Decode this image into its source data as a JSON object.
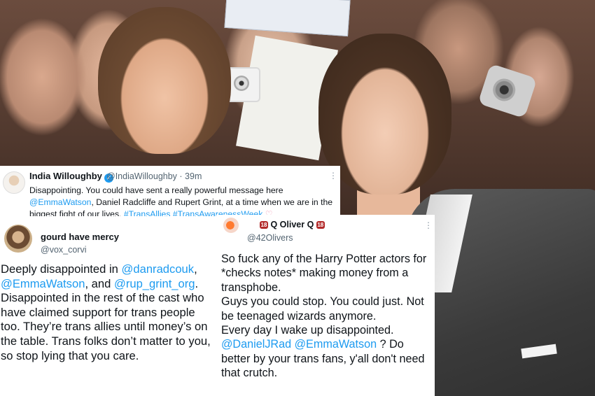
{
  "tweet_india": {
    "name": "India Willoughby",
    "handle": "@IndiaWilloughby",
    "time": "· 39m",
    "text_start": "Disappointing. You could have sent a really powerful message here",
    "mention_1": "@EmmaWatson",
    "text_mid": ", Daniel Radcliffe and Rupert Grint, at a time when we are in the biggest fight of our lives. ",
    "hashtag_1": "#TransAllies",
    "hashtag_2": "#TransAwarenessWeek",
    "emoji": "♡",
    "more_icon": "ellipsis-icon"
  },
  "tweet_gourd": {
    "name": "gourd have mercy",
    "handle": "@vox_corvi",
    "text_1": "Deeply disappointed in ",
    "mention_1": "@danradcouk",
    "text_2": ", ",
    "mention_2": "@EmmaWatson",
    "text_3": ", and ",
    "mention_3": "@rup_grint_org",
    "text_4": ". Disappointed in the rest of the cast who have claimed support for trans people too. They’re trans allies until money’s on the table. Trans folks don’t matter to you, so stop lying that you care."
  },
  "tweet_oliver": {
    "badge_left": "18",
    "name": "Q Oliver Q",
    "badge_right": "18",
    "handle": "@42Olivers",
    "text_1": "So fuck any of the Harry Potter actors for *checks notes* making money from a transphobe.",
    "text_2": "Guys you could stop. You could just. Not be teenaged wizards anymore.",
    "text_3": "Every day I wake up disappointed.",
    "mention_1": "@DanielJRad",
    "mention_2": "@EmmaWatson",
    "text_4": " ? Do better by your trans fans, y'all don't need that crutch.",
    "more_icon": "ellipsis-icon"
  },
  "colors": {
    "link": "#1d9bf0",
    "verified": "#1d9bf0",
    "text": "#0f1419",
    "muted": "#536471"
  }
}
